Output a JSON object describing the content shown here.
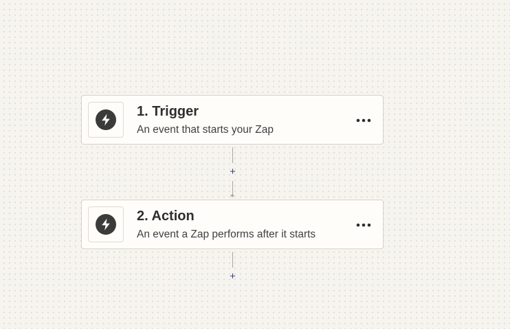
{
  "steps": [
    {
      "title": "1. Trigger",
      "description": "An event that starts your Zap",
      "icon": "bolt-icon",
      "menu_icon": "more-horizontal-icon"
    },
    {
      "title": "2. Action",
      "description": "An event a Zap performs after it starts",
      "icon": "bolt-icon",
      "menu_icon": "more-horizontal-icon"
    }
  ],
  "add_step_label": "+",
  "colors": {
    "canvas_background": "#f6f4ef",
    "card_background": "#fffdf9",
    "card_border": "#d7d3ca",
    "icon_circle": "#3b3b3a",
    "add_step": "#3c3f7a",
    "connector": "#a9a6a0"
  }
}
